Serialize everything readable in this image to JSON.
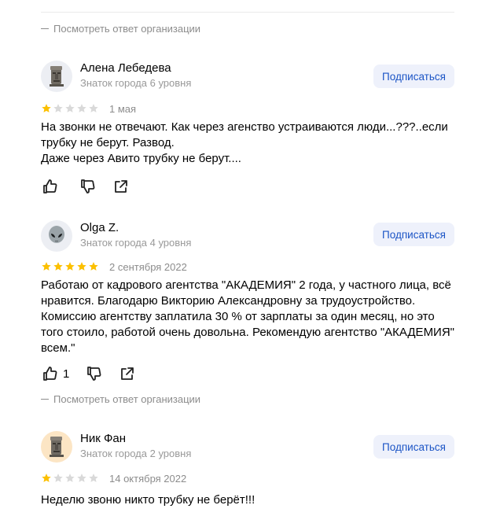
{
  "top_link": "Посмотреть ответ организации",
  "reviews": [
    {
      "author": "Алена Лебедева",
      "level": "Знаток города 6 уровня",
      "subscribe": "Подписаться",
      "rating": 1,
      "date": "1 мая",
      "text": "На звонки не отвечают. Как через агенство устраиваются люди...???..если трубку не берут. Развод.\nДаже через Авито трубку не берут....",
      "likes": ""
    },
    {
      "author": "Olga Z.",
      "level": "Знаток города 4 уровня",
      "subscribe": "Подписаться",
      "rating": 5,
      "date": "2 сентября 2022",
      "text": "Работаю от кадрового агентства \"АКАДЕМИЯ\" 2 года, у частного лица, всё нравится. Благодарю Викторию Александровну за трудоустройство. Комиссию агентству заплатила 30 % от зарплаты за один месяц, но это того стоило, работой очень довольна. Рекомендую агентство \"АКАДЕМИЯ\" всем.\"",
      "likes": "1",
      "org_link": "Посмотреть ответ организации"
    },
    {
      "author": "Ник Фан",
      "level": "Знаток города 2 уровня",
      "subscribe": "Подписаться",
      "rating": 1,
      "date": "14 октября 2022",
      "text": "Неделю звоню никто трубку не берёт!!!"
    }
  ],
  "colors": {
    "star_on": "#fcc000",
    "star_off": "#d9d9d9",
    "accent": "#1c55c6",
    "button_bg": "#eef1fb"
  },
  "icons": [
    "moai-avatar-icon",
    "alien-avatar-icon",
    "star-icon",
    "thumb-up-icon",
    "thumb-down-icon",
    "share-icon"
  ]
}
